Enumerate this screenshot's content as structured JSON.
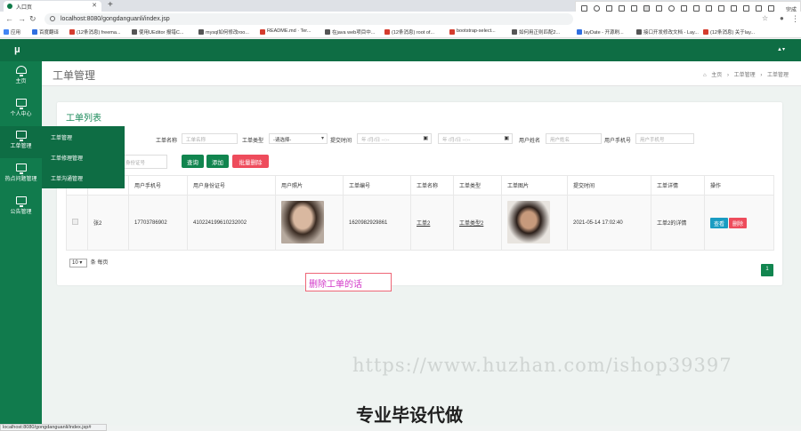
{
  "browser": {
    "tab_title": "入口页",
    "url": "localhost:8080/gongdanguanli/index.jsp",
    "status_url": "localhost:8080/gongdanguanli/index.jsp#",
    "bookmarks": [
      {
        "label": "应用",
        "color": "#4285f4"
      },
      {
        "label": "百度翻译",
        "color": "#2f6fe0"
      },
      {
        "label": "(12条消息) freema...",
        "color": "#d43c2e"
      },
      {
        "label": "使用UEditor 报错C...",
        "color": "#333333"
      },
      {
        "label": "mysql如何修改roo...",
        "color": "#333333"
      },
      {
        "label": "README.md · Ter...",
        "color": "#d43c2e"
      },
      {
        "label": "在java web项目中...",
        "color": "#333333"
      },
      {
        "label": "(12条消息) root of...",
        "color": "#d43c2e"
      },
      {
        "label": "bootstrap-select...",
        "color": "#d43c2e"
      },
      {
        "label": "如何用正则匹配2...",
        "color": "#333333"
      },
      {
        "label": "layDate - 开源刷...",
        "color": "#2f6fe0"
      },
      {
        "label": "接口开发修改文档 - Lay...",
        "color": "#333333"
      },
      {
        "label": "(12条消息) 关于lay...",
        "color": "#d43c2e"
      }
    ],
    "annotate": {
      "font_size": "18",
      "done_label": "完成",
      "colors": [
        "#ff00ff",
        "#000000",
        "#ffffff",
        "#cc3333",
        "#33aa66",
        "#3366cc",
        "#996633",
        "#9933cc"
      ]
    }
  },
  "app": {
    "logo": "μ",
    "sidebar": [
      {
        "label": "主页"
      },
      {
        "label": "个人中心"
      },
      {
        "label": "工单管理"
      },
      {
        "label": "热点问题管理"
      },
      {
        "label": "公告管理"
      }
    ],
    "submenu": [
      "工单管理",
      "工单修理管理",
      "工单沟通管理"
    ],
    "page_title": "工单管理",
    "breadcrumb": [
      "主页",
      "工单管理",
      "工单管理"
    ],
    "card_title": "工单列表"
  },
  "filters": {
    "order_name_label": "工单名称",
    "order_name_placeholder": "工单名称",
    "order_type_label": "工单类型",
    "order_type_value": "-请选择-",
    "submit_time_label": "提交时间",
    "date_placeholder": "年 /月/日 --:--",
    "user_name_label": "用户姓名",
    "user_name_placeholder": "用户姓名",
    "user_phone_label": "用户手机号",
    "user_phone_placeholder": "用户手机号",
    "id_card_placeholder": "身份证号"
  },
  "buttons": {
    "search": "查询",
    "add": "添加",
    "batch_delete": "批量删除"
  },
  "table": {
    "headers": [
      "",
      "",
      "用户手机号",
      "用户身份证号",
      "用户照片",
      "工单编号",
      "工单名称",
      "工单类型",
      "工单图片",
      "提交时间",
      "工单详情",
      "操作"
    ],
    "rows": [
      {
        "name": "张2",
        "phone": "17703786902",
        "id_card": "410224199610232002",
        "order_no": "1620982929861",
        "order_name": "工单2",
        "order_type": "工单类型2",
        "submit_time": "2021-05-14 17:02:40",
        "detail": "工单2的详情",
        "view": "查看",
        "delete": "删除"
      }
    ]
  },
  "pagination": {
    "page_size": "10",
    "per_page_label": "条 每页",
    "current_page": "1"
  },
  "overlay": {
    "note": "删除工单的话",
    "watermark": "https://www.huzhan.com/ishop39397",
    "slogan": "专业毕设代做"
  }
}
